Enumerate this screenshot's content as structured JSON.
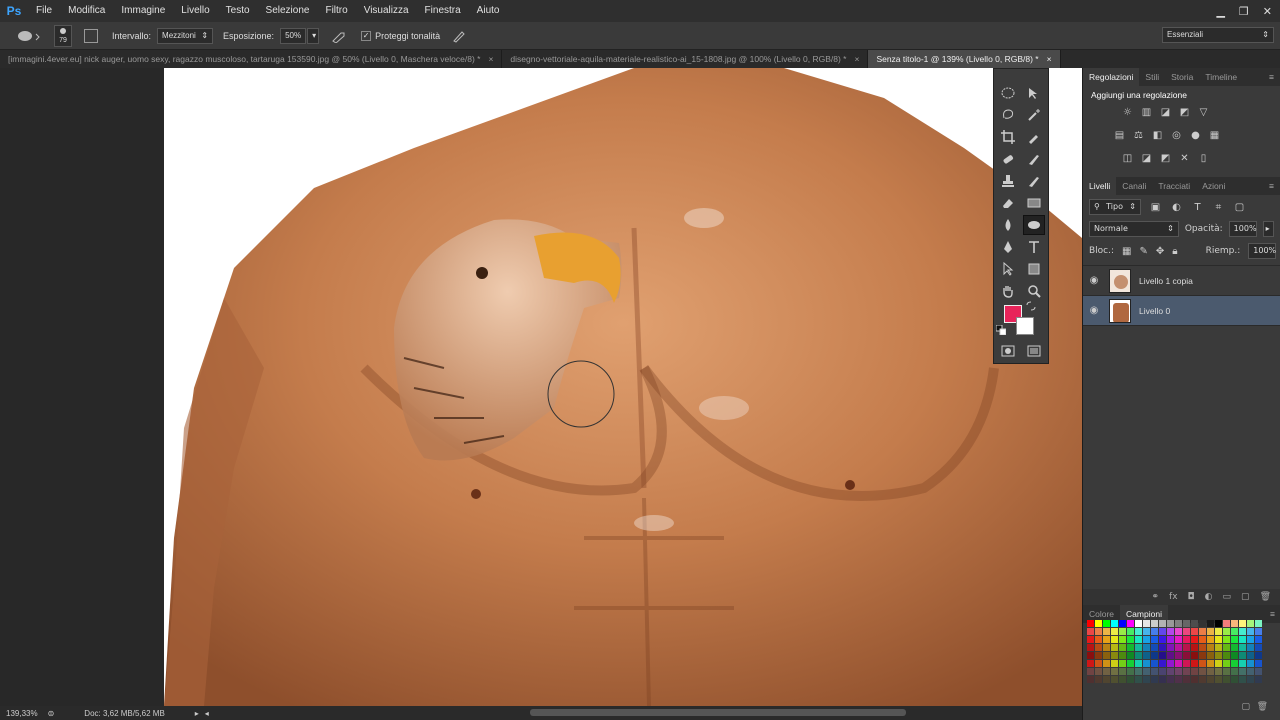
{
  "app": {
    "logo": "Ps"
  },
  "menu": [
    "File",
    "Modifica",
    "Immagine",
    "Livello",
    "Testo",
    "Selezione",
    "Filtro",
    "Visualizza",
    "Finestra",
    "Aiuto"
  ],
  "options": {
    "brush_size": "79",
    "intervallo_label": "Intervallo:",
    "intervallo_value": "Mezzitoni",
    "esposizione_label": "Esposizione:",
    "esposizione_value": "50%",
    "protect_label": "Proteggi tonalità",
    "workspace": "Essenziali"
  },
  "tabs": [
    {
      "label": "[immagini.4ever.eu] nick auger, uomo sexy, ragazzo muscoloso, tartaruga 153590.jpg @ 50% (Livello 0, Maschera veloce/8) *",
      "close": "×"
    },
    {
      "label": "disegno-vettoriale-aquila-materiale-realistico-ai_15-1808.jpg @ 100% (Livello 0, RGB/8) *",
      "close": "×"
    },
    {
      "label": "Senza titolo-1 @ 139% (Livello 0, RGB/8) *",
      "close": "×"
    }
  ],
  "panels": {
    "top_tabs": [
      "Regolazioni",
      "Stili",
      "Storia",
      "Timeline"
    ],
    "add_adjustment": "Aggiungi una regolazione",
    "layer_tabs": [
      "Livelli",
      "Canali",
      "Tracciati",
      "Azioni"
    ],
    "filter_kind": "Tipo",
    "blend_mode": "Normale",
    "opacity_label": "Opacità:",
    "opacity_value": "100%",
    "lock_label": "Bloc.:",
    "fill_label": "Riemp.:",
    "fill_value": "100%",
    "layers": [
      {
        "name": "Livello 1 copia",
        "selected": false
      },
      {
        "name": "Livello 0",
        "selected": true
      }
    ],
    "bottom_tabs": [
      "Colore",
      "Campioni"
    ]
  },
  "status": {
    "zoom": "139,33%",
    "doc": "Doc: 3,62 MB/5,62 MB"
  },
  "colors": {
    "foreground": "#e8245a",
    "background": "#ffffff",
    "skin": "#c97a4a"
  }
}
